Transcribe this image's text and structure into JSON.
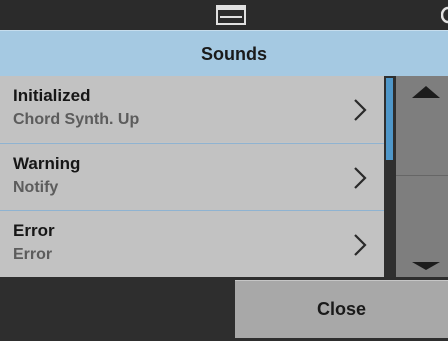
{
  "header": {
    "title": "Sounds",
    "status_icon": "printer-tray-icon"
  },
  "list": {
    "items": [
      {
        "label": "Initialized",
        "value": "Chord Synth. Up",
        "icon": "chevron-right-icon"
      },
      {
        "label": "Warning",
        "value": "Notify",
        "icon": "chevron-right-icon"
      },
      {
        "label": "Error",
        "value": "Error",
        "icon": "chevron-right-icon"
      }
    ]
  },
  "scroll": {
    "up_icon": "scroll-up-arrow-icon",
    "down_icon": "scroll-down-arrow-icon"
  },
  "footer": {
    "close_label": "Close"
  },
  "colors": {
    "title_bar": "#a5c9e2",
    "list_bg": "#c2c2c2",
    "scroll_thumb": "#4f97c9",
    "button_bg": "#a8a8a8",
    "background": "#2e2e2e"
  }
}
